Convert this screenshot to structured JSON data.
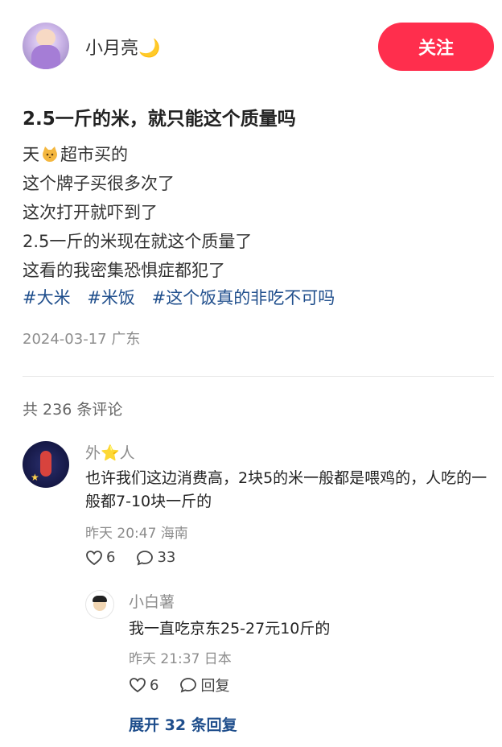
{
  "author": {
    "name": "小月亮🌙",
    "follow_label": "关注"
  },
  "post": {
    "title": "2.5一斤的米，就只能这个质量吗",
    "lines": [
      {
        "before": "天",
        "after": "超市买的"
      },
      "这个牌子买很多次了",
      "这次打开就吓到了",
      "2.5一斤的米现在就这个质量了",
      "这看的我密集恐惧症都犯了"
    ],
    "tags": [
      "#大米",
      "#米饭",
      "#这个饭真的非吃不可吗"
    ],
    "date_location": "2024-03-17 广东"
  },
  "comments_header": "共 236 条评论",
  "comment": {
    "name": "外⭐人",
    "text": "也许我们这边消费高，2块5的米一般都是喂鸡的，人吃的一般都7-10块一斤的",
    "meta": "昨天 20:47 海南",
    "likes": "6",
    "replies": "33",
    "reply": {
      "name": "小白薯",
      "text": "我一直吃京东25-27元10斤的",
      "meta": "昨天 21:37 日本",
      "likes": "6",
      "reply_label": "回复"
    }
  },
  "expand_label": "展开 32 条回复",
  "colors": {
    "accent": "#ff2e4d",
    "link": "#1f4e8c",
    "muted": "#8c8c8c"
  },
  "icons": [
    "cat-icon",
    "heart-icon",
    "comment-icon"
  ]
}
